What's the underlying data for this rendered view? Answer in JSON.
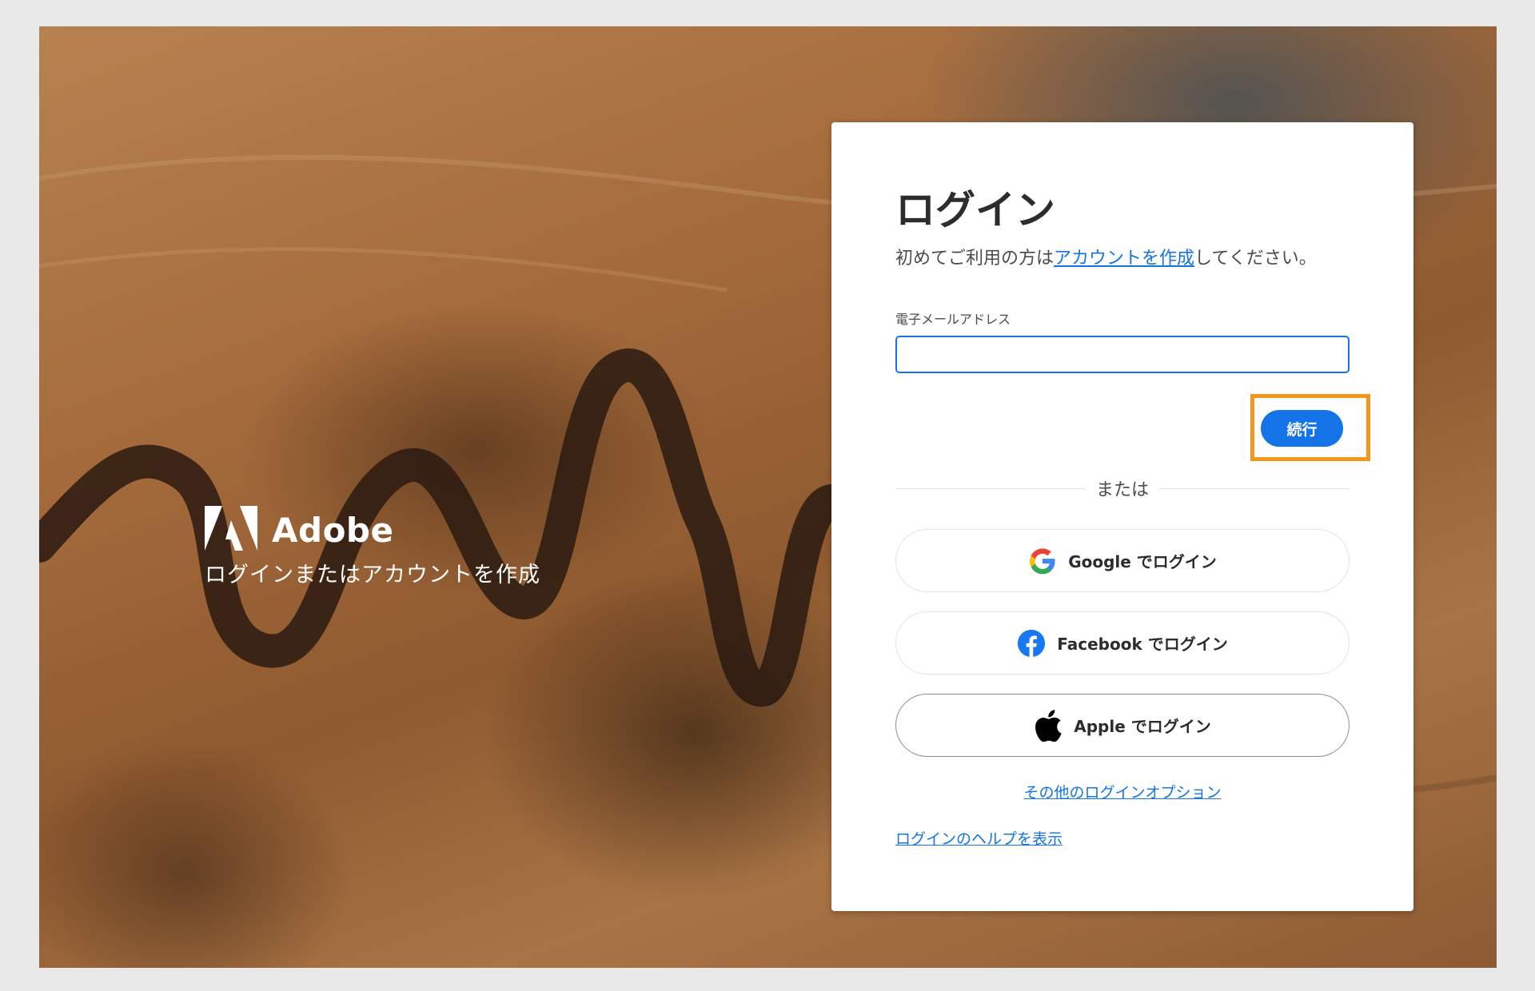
{
  "brand": {
    "name": "Adobe",
    "tagline": "ログインまたはアカウントを作成"
  },
  "login": {
    "title": "ログイン",
    "subtitle_prefix": "初めてご利用の方は",
    "create_account_link": "アカウントを作成",
    "subtitle_suffix": "してください。",
    "email_label": "電子メールアドレス",
    "email_value": "",
    "continue_label": "続行",
    "divider_text": "または",
    "google_label": "Google でログイン",
    "facebook_label": "Facebook でログイン",
    "apple_label": "Apple でログイン",
    "other_options_link": "その他のログインオプション",
    "help_link": "ログインのヘルプを表示"
  },
  "colors": {
    "accent": "#1473e6",
    "highlight": "#f3961d",
    "google_blue": "#4285f4",
    "google_red": "#ea4335",
    "google_yellow": "#fbbc05",
    "google_green": "#34a853",
    "facebook": "#1877f2"
  },
  "icons": {
    "brand": "adobe-logo-icon",
    "google": "google-icon",
    "facebook": "facebook-icon",
    "apple": "apple-icon"
  }
}
